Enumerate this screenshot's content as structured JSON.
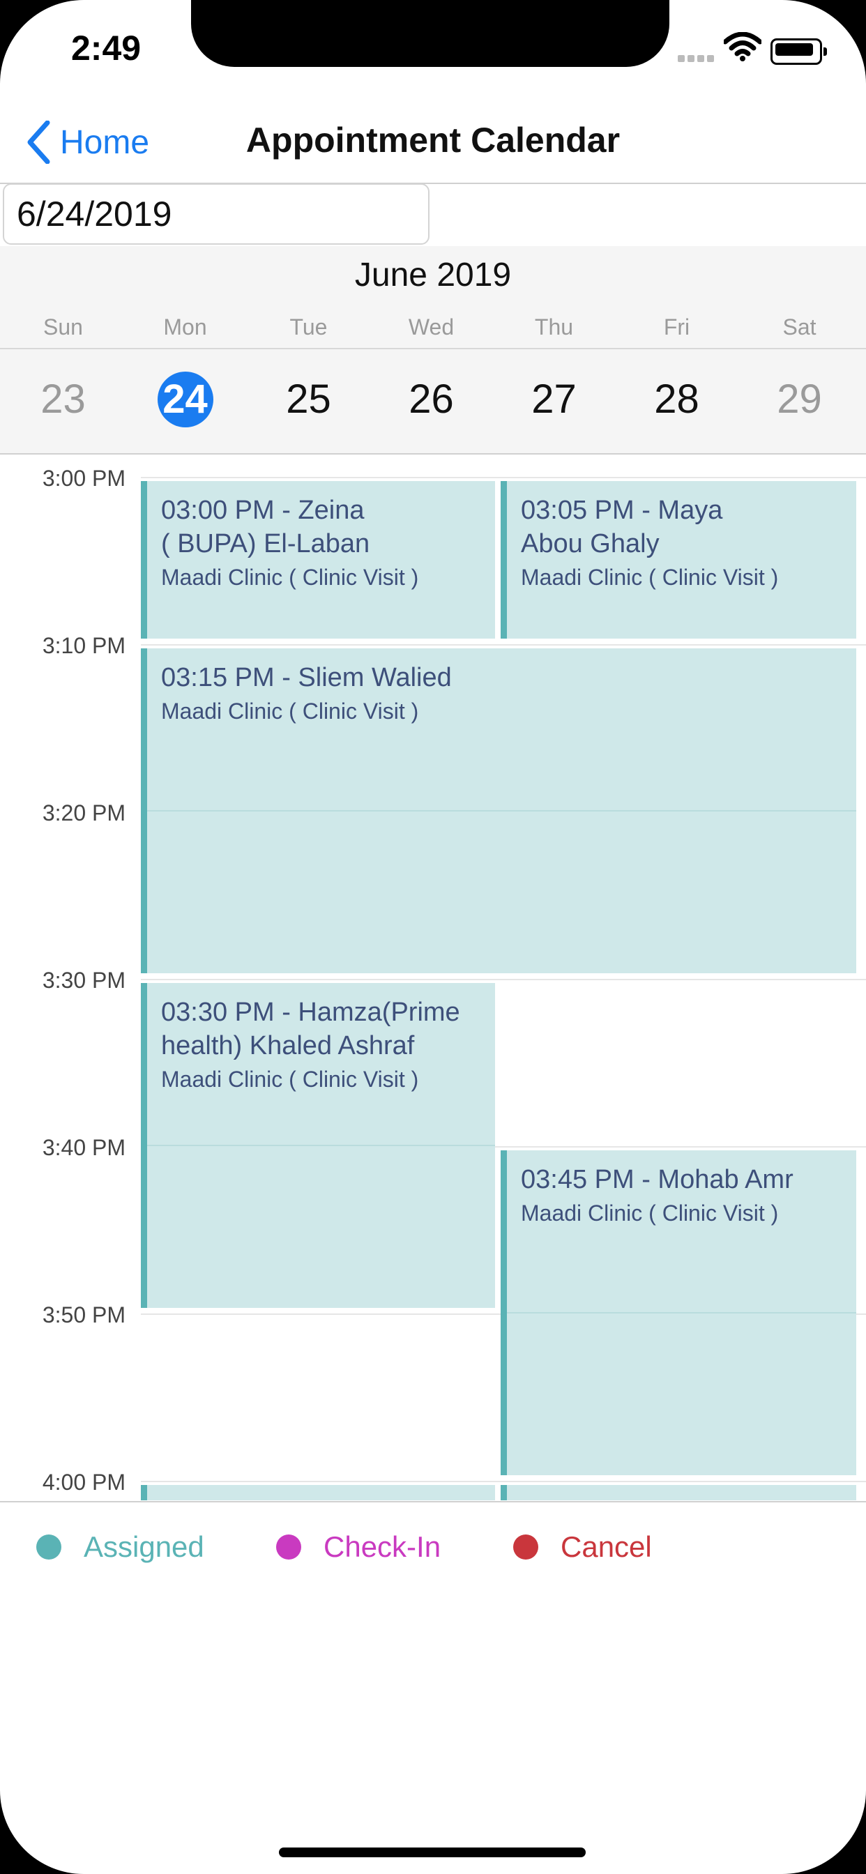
{
  "status": {
    "time": "2:49"
  },
  "nav": {
    "back_label": "Home",
    "title": "Appointment Calendar"
  },
  "date_field": {
    "value": "6/24/2019"
  },
  "calendar": {
    "month": "June 2019",
    "weekdays": [
      "Sun",
      "Mon",
      "Tue",
      "Wed",
      "Thu",
      "Fri",
      "Sat"
    ],
    "days": [
      "23",
      "24",
      "25",
      "26",
      "27",
      "28",
      "29"
    ],
    "selected_day": "24"
  },
  "time_labels": [
    "3:00 PM",
    "3:10 PM",
    "3:20 PM",
    "3:30 PM",
    "3:40 PM",
    "3:50 PM",
    "4:00 PM"
  ],
  "appointments": [
    {
      "title_line1": "03:00 PM - Zeina",
      "title_line2": "( BUPA) El-Laban",
      "location": "Maadi Clinic ( Clinic Visit )"
    },
    {
      "title_line1": "03:05 PM - Maya",
      "title_line2": "Abou Ghaly",
      "location": "Maadi Clinic ( Clinic Visit )"
    },
    {
      "title_line1": "03:15 PM - Sliem Walied",
      "title_line2": "",
      "location": "Maadi Clinic ( Clinic Visit )"
    },
    {
      "title_line1": "03:30 PM - Hamza(Prime",
      "title_line2": "health) Khaled Ashraf",
      "location": "Maadi Clinic ( Clinic Visit )"
    },
    {
      "title_line1": "03:45 PM - Mohab Amr",
      "title_line2": "",
      "location": "Maadi Clinic ( Clinic Visit )"
    }
  ],
  "legend": [
    {
      "label": "Assigned",
      "color": "#5ab3b5"
    },
    {
      "label": "Check-In",
      "color": "#c93ac0"
    },
    {
      "label": "Cancel",
      "color": "#c9363c"
    }
  ]
}
